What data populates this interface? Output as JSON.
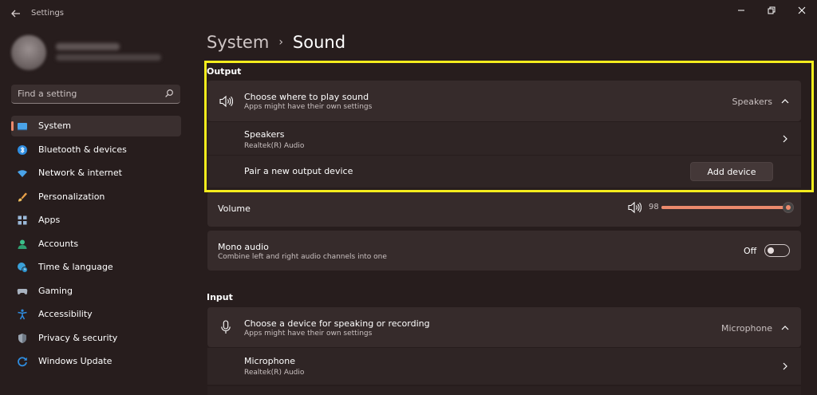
{
  "window": {
    "title": "Settings",
    "back_icon": "back-arrow-icon",
    "controls": [
      "minimize-icon",
      "restore-icon",
      "close-icon"
    ]
  },
  "sidebar": {
    "search": {
      "placeholder": "Find a setting"
    },
    "items": [
      {
        "label": "System",
        "icon": "system-icon",
        "active": true
      },
      {
        "label": "Bluetooth & devices",
        "icon": "bluetooth-icon"
      },
      {
        "label": "Network & internet",
        "icon": "wifi-icon"
      },
      {
        "label": "Personalization",
        "icon": "brush-icon"
      },
      {
        "label": "Apps",
        "icon": "apps-icon"
      },
      {
        "label": "Accounts",
        "icon": "account-icon"
      },
      {
        "label": "Time & language",
        "icon": "globe-clock-icon"
      },
      {
        "label": "Gaming",
        "icon": "gamepad-icon"
      },
      {
        "label": "Accessibility",
        "icon": "accessibility-icon"
      },
      {
        "label": "Privacy & security",
        "icon": "shield-icon"
      },
      {
        "label": "Windows Update",
        "icon": "update-icon"
      }
    ]
  },
  "breadcrumb": {
    "root": "System",
    "separator": "›",
    "current": "Sound"
  },
  "output": {
    "section_title": "Output",
    "choose": {
      "title": "Choose where to play sound",
      "subtitle": "Apps might have their own settings",
      "value": "Speakers"
    },
    "device": {
      "title": "Speakers",
      "subtitle": "Realtek(R) Audio"
    },
    "pair": {
      "title": "Pair a new output device",
      "button": "Add device"
    },
    "volume": {
      "label": "Volume",
      "value": "98",
      "level": 98
    },
    "mono": {
      "title": "Mono audio",
      "subtitle": "Combine left and right audio channels into one",
      "state_label": "Off"
    }
  },
  "input": {
    "section_title": "Input",
    "choose": {
      "title": "Choose a device for speaking or recording",
      "subtitle": "Apps might have their own settings",
      "value": "Microphone"
    },
    "device": {
      "title": "Microphone",
      "subtitle": "Realtek(R) Audio"
    }
  },
  "colors": {
    "accent": "#ec8a6c",
    "highlight_box": "#f4ec1d",
    "background": "#271d1d",
    "card": "#362b2b"
  }
}
